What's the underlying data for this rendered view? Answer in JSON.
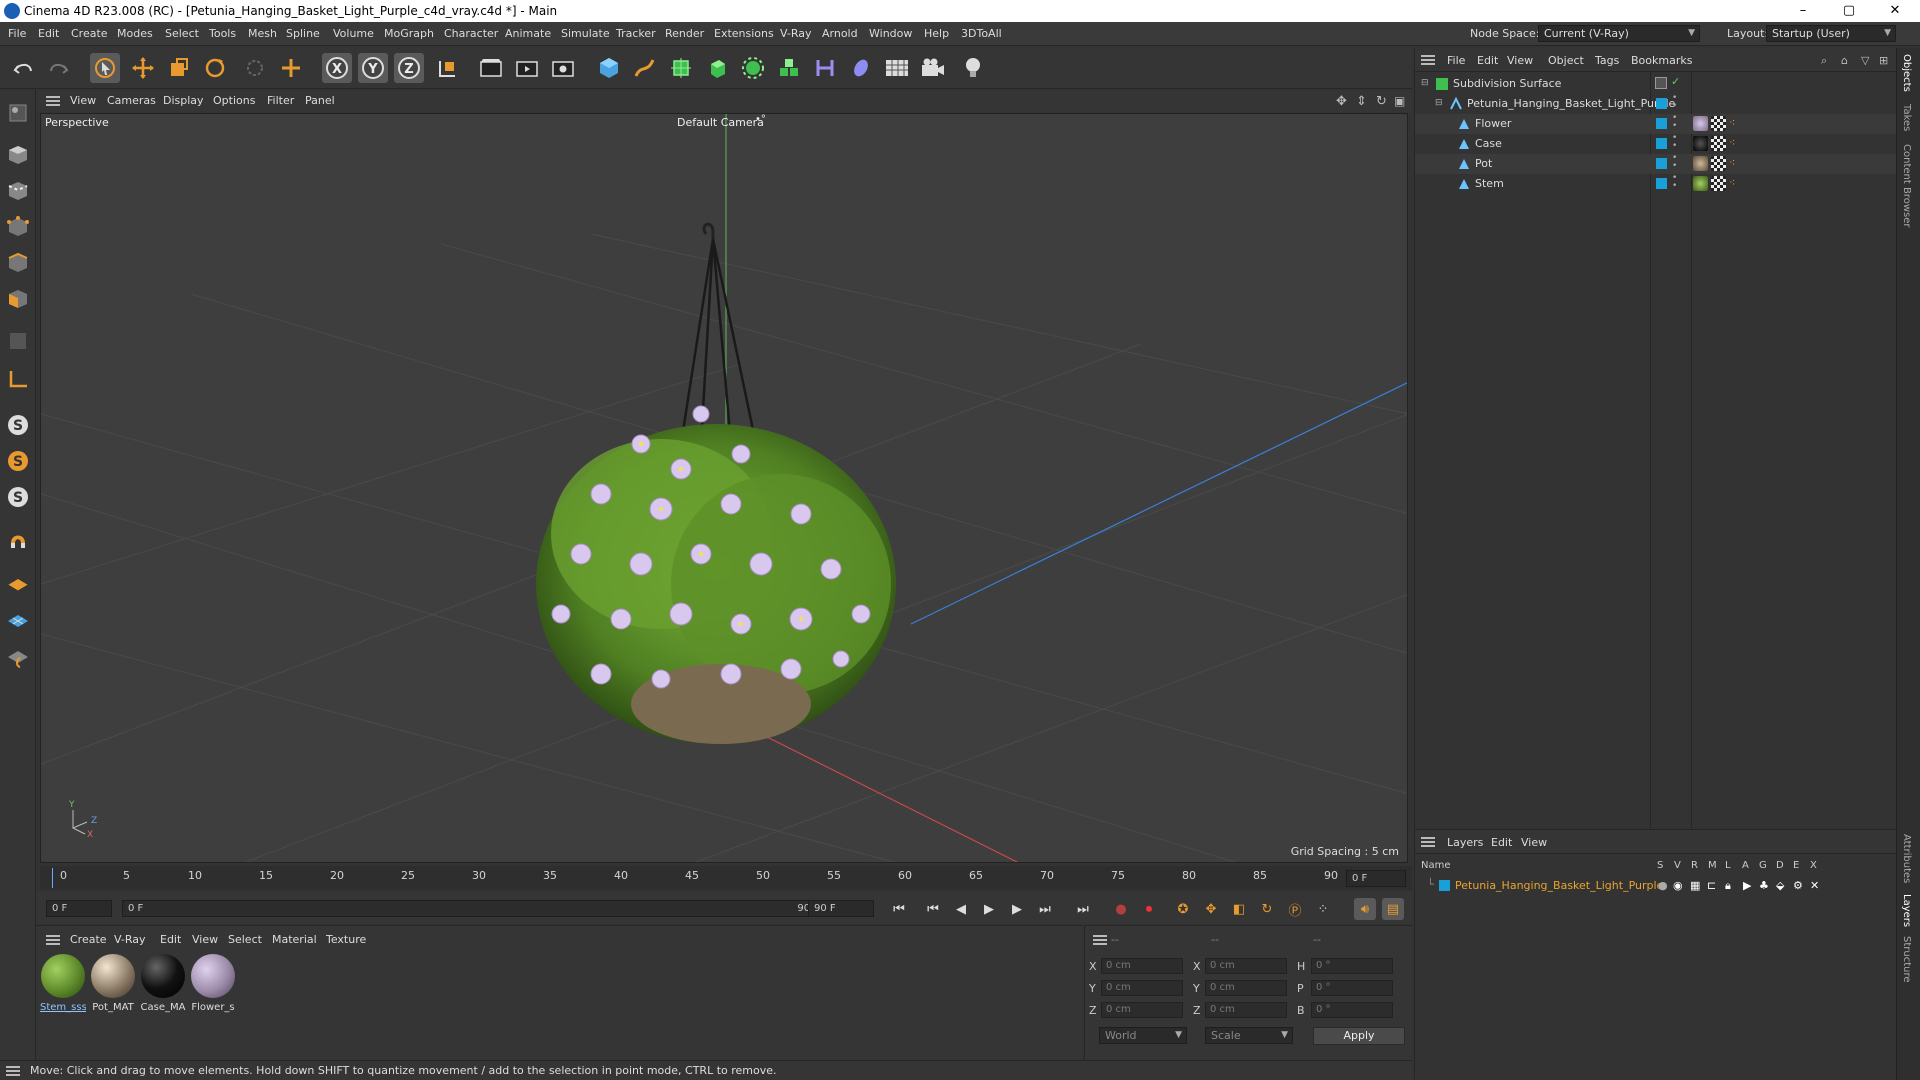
{
  "window": {
    "title": "Cinema 4D R23.008 (RC) - [Petunia_Hanging_Basket_Light_Purple_c4d_vray.c4d *] - Main",
    "minimize": "–",
    "maximize": "▢",
    "close": "✕"
  },
  "menubar": {
    "items": [
      "File",
      "Edit",
      "Create",
      "Modes",
      "Select",
      "Tools",
      "Mesh",
      "Spline",
      "Volume",
      "MoGraph",
      "Character",
      "Animate",
      "Simulate",
      "Tracker",
      "Render",
      "Extensions",
      "V-Ray",
      "Arnold",
      "Window",
      "Help",
      "3DToAll"
    ],
    "node_space_label": "Node Space:",
    "node_space_value": "Current (V-Ray)",
    "layout_label": "Layout:",
    "layout_value": "Startup (User)"
  },
  "toolbar": {
    "icons": [
      "undo-icon",
      "redo-icon",
      "select-icon",
      "move-icon",
      "scale-icon",
      "rotate-icon",
      "live-select-icon",
      "create-icon",
      "x-axis-icon",
      "y-axis-icon",
      "z-axis-icon",
      "coordinate-system-icon",
      "render-region-icon",
      "render-view-icon",
      "render-settings-icon",
      "cube-icon",
      "pen-icon",
      "subdivision-icon",
      "extrude-icon",
      "cloner-icon",
      "array-icon",
      "deformer-icon",
      "field-icon",
      "floor-icon",
      "camera-icon",
      "light-icon"
    ]
  },
  "viewport": {
    "menu": [
      "View",
      "Cameras",
      "Display",
      "Options",
      "Filter",
      "Panel"
    ],
    "label": "Perspective",
    "camera": "Default Camera",
    "grid_spacing": "Grid Spacing : 5 cm",
    "axis_y": "Y",
    "axis_z": "Z",
    "axis_x": "X"
  },
  "timeline": {
    "ticks": [
      "0",
      "5",
      "10",
      "15",
      "20",
      "25",
      "30",
      "35",
      "40",
      "45",
      "50",
      "55",
      "60",
      "65",
      "70",
      "75",
      "80",
      "85",
      "90"
    ],
    "current_frame": "0 F",
    "start_field": "0 F",
    "range_start": "0 F",
    "range_end": "90 F",
    "end_field": "90 F"
  },
  "materials": {
    "menu": [
      "Create",
      "V-Ray",
      "Edit",
      "View",
      "Select",
      "Material",
      "Texture"
    ],
    "items": [
      {
        "label": "Stem_sss",
        "color": "#5d8a2a"
      },
      {
        "label": "Pot_MAT",
        "color": "#8a7a66"
      },
      {
        "label": "Case_MA",
        "color": "#111111"
      },
      {
        "label": "Flower_s",
        "color": "#9b8aa8"
      }
    ]
  },
  "coordinates": {
    "headers": [
      "--",
      "--",
      "--"
    ],
    "rows": [
      {
        "a": "X",
        "av": "0 cm",
        "b": "X",
        "bv": "0 cm",
        "c": "H",
        "cv": "0 °"
      },
      {
        "a": "Y",
        "av": "0 cm",
        "b": "Y",
        "bv": "0 cm",
        "c": "P",
        "cv": "0 °"
      },
      {
        "a": "Z",
        "av": "0 cm",
        "b": "Z",
        "bv": "0 cm",
        "c": "B",
        "cv": "0 °"
      }
    ],
    "mode1": "World",
    "mode2": "Scale",
    "apply": "Apply"
  },
  "status": "Move: Click and drag to move elements. Hold down SHIFT to quantize movement / add to the selection in point mode, CTRL to remove.",
  "objects": {
    "menu": [
      "File",
      "Edit",
      "View",
      "Object",
      "Tags",
      "Bookmarks"
    ],
    "tree": [
      {
        "name": "Subdivision Surface"
      },
      {
        "name": "Petunia_Hanging_Basket_Light_Purple"
      },
      {
        "name": "Flower"
      },
      {
        "name": "Case"
      },
      {
        "name": "Pot"
      },
      {
        "name": "Stem"
      }
    ]
  },
  "layers": {
    "menu": [
      "Layers",
      "Edit",
      "View"
    ],
    "columns": [
      "Name",
      "S",
      "V",
      "R",
      "M",
      "L",
      "A",
      "G",
      "D",
      "E",
      "X"
    ],
    "items": [
      {
        "name": "Petunia_Hanging_Basket_Light_Purple",
        "color": "#e8a530"
      }
    ]
  },
  "right_tabs": [
    "Objects",
    "Takes",
    "Content Browser",
    "Attributes",
    "Layers",
    "Structure"
  ]
}
